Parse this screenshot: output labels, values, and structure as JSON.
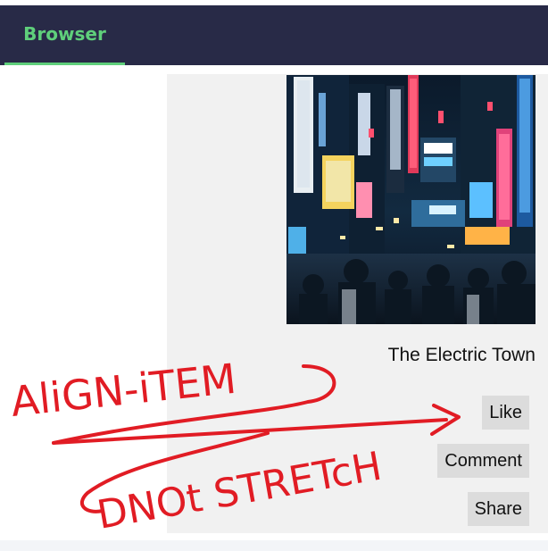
{
  "tab": {
    "label": "Browser"
  },
  "card": {
    "image_alt": "Neon-lit city street at night",
    "caption": "The Electric Town",
    "buttons": {
      "like": "Like",
      "comment": "Comment",
      "share": "Share"
    }
  },
  "annotation": {
    "line1": "AliGN-iTEM",
    "line2": "DNOt STRETcH",
    "color": "#e11c24"
  },
  "colors": {
    "topbar": "#282a47",
    "accent": "#5fcf7b",
    "panel": "#f1f1f1",
    "button": "#dcdcdc"
  }
}
